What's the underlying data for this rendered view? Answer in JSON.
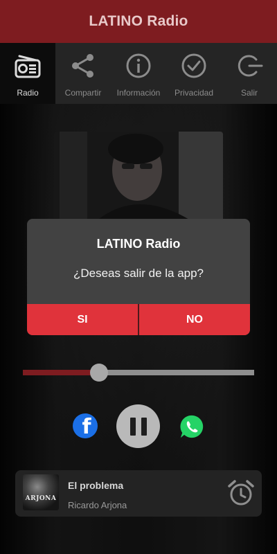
{
  "app": {
    "title": "LATINO Radio"
  },
  "nav": {
    "items": [
      {
        "label": "Radio",
        "icon": "radio-icon",
        "active": true
      },
      {
        "label": "Compartir",
        "icon": "share-icon",
        "active": false
      },
      {
        "label": "Información",
        "icon": "info-icon",
        "active": false
      },
      {
        "label": "Privacidad",
        "icon": "check-circle-icon",
        "active": false
      },
      {
        "label": "Salir",
        "icon": "exit-icon",
        "active": false
      }
    ]
  },
  "dialog": {
    "title": "LATINO Radio",
    "message": "¿Deseas salir de la app?",
    "yes_label": "SI",
    "no_label": "NO"
  },
  "player": {
    "progress": 0.33,
    "state": "playing"
  },
  "social": {
    "facebook_icon": "facebook-icon",
    "whatsapp_icon": "whatsapp-icon"
  },
  "now_playing": {
    "title": "El problema",
    "artist": "Ricardo Arjona",
    "thumb_text": "ARJONA",
    "alarm_icon": "alarm-clock-icon"
  },
  "colors": {
    "header": "#7e1c20",
    "accent_red": "#e0333b",
    "nav_bg": "#252525",
    "dialog_bg": "#424242",
    "facebook_blue": "#1b6fe6",
    "whatsapp_green": "#25d366"
  }
}
